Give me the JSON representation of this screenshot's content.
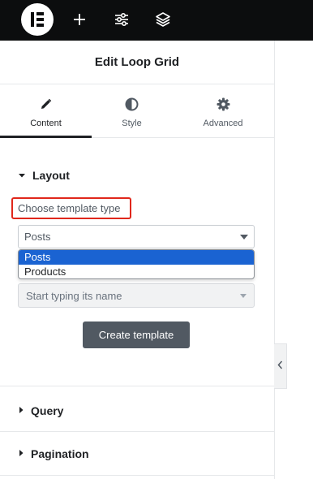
{
  "toolbar": {
    "icons": [
      "elementor-logo-icon",
      "plus-icon",
      "settings-sliders-icon",
      "layers-icon"
    ]
  },
  "panel": {
    "title": "Edit Loop Grid",
    "tabs": [
      {
        "label": "Content",
        "icon": "pencil-icon",
        "active": true
      },
      {
        "label": "Style",
        "icon": "half-circle-icon",
        "active": false
      },
      {
        "label": "Advanced",
        "icon": "gear-icon",
        "active": false
      }
    ]
  },
  "layout_section": {
    "title": "Layout",
    "template_type_label": "Choose template type",
    "template_type_value": "Posts",
    "template_type_options": [
      {
        "label": "Posts",
        "selected": true
      },
      {
        "label": "Products",
        "selected": false
      }
    ],
    "template_search_placeholder": "Start typing its name",
    "create_button": "Create template"
  },
  "sections": {
    "query": "Query",
    "pagination": "Pagination"
  },
  "colors": {
    "toolbar_bg": "#0c0d0e",
    "highlight_border": "#e0271b",
    "selected_option": "#1a63d2",
    "button_bg": "#515962"
  }
}
